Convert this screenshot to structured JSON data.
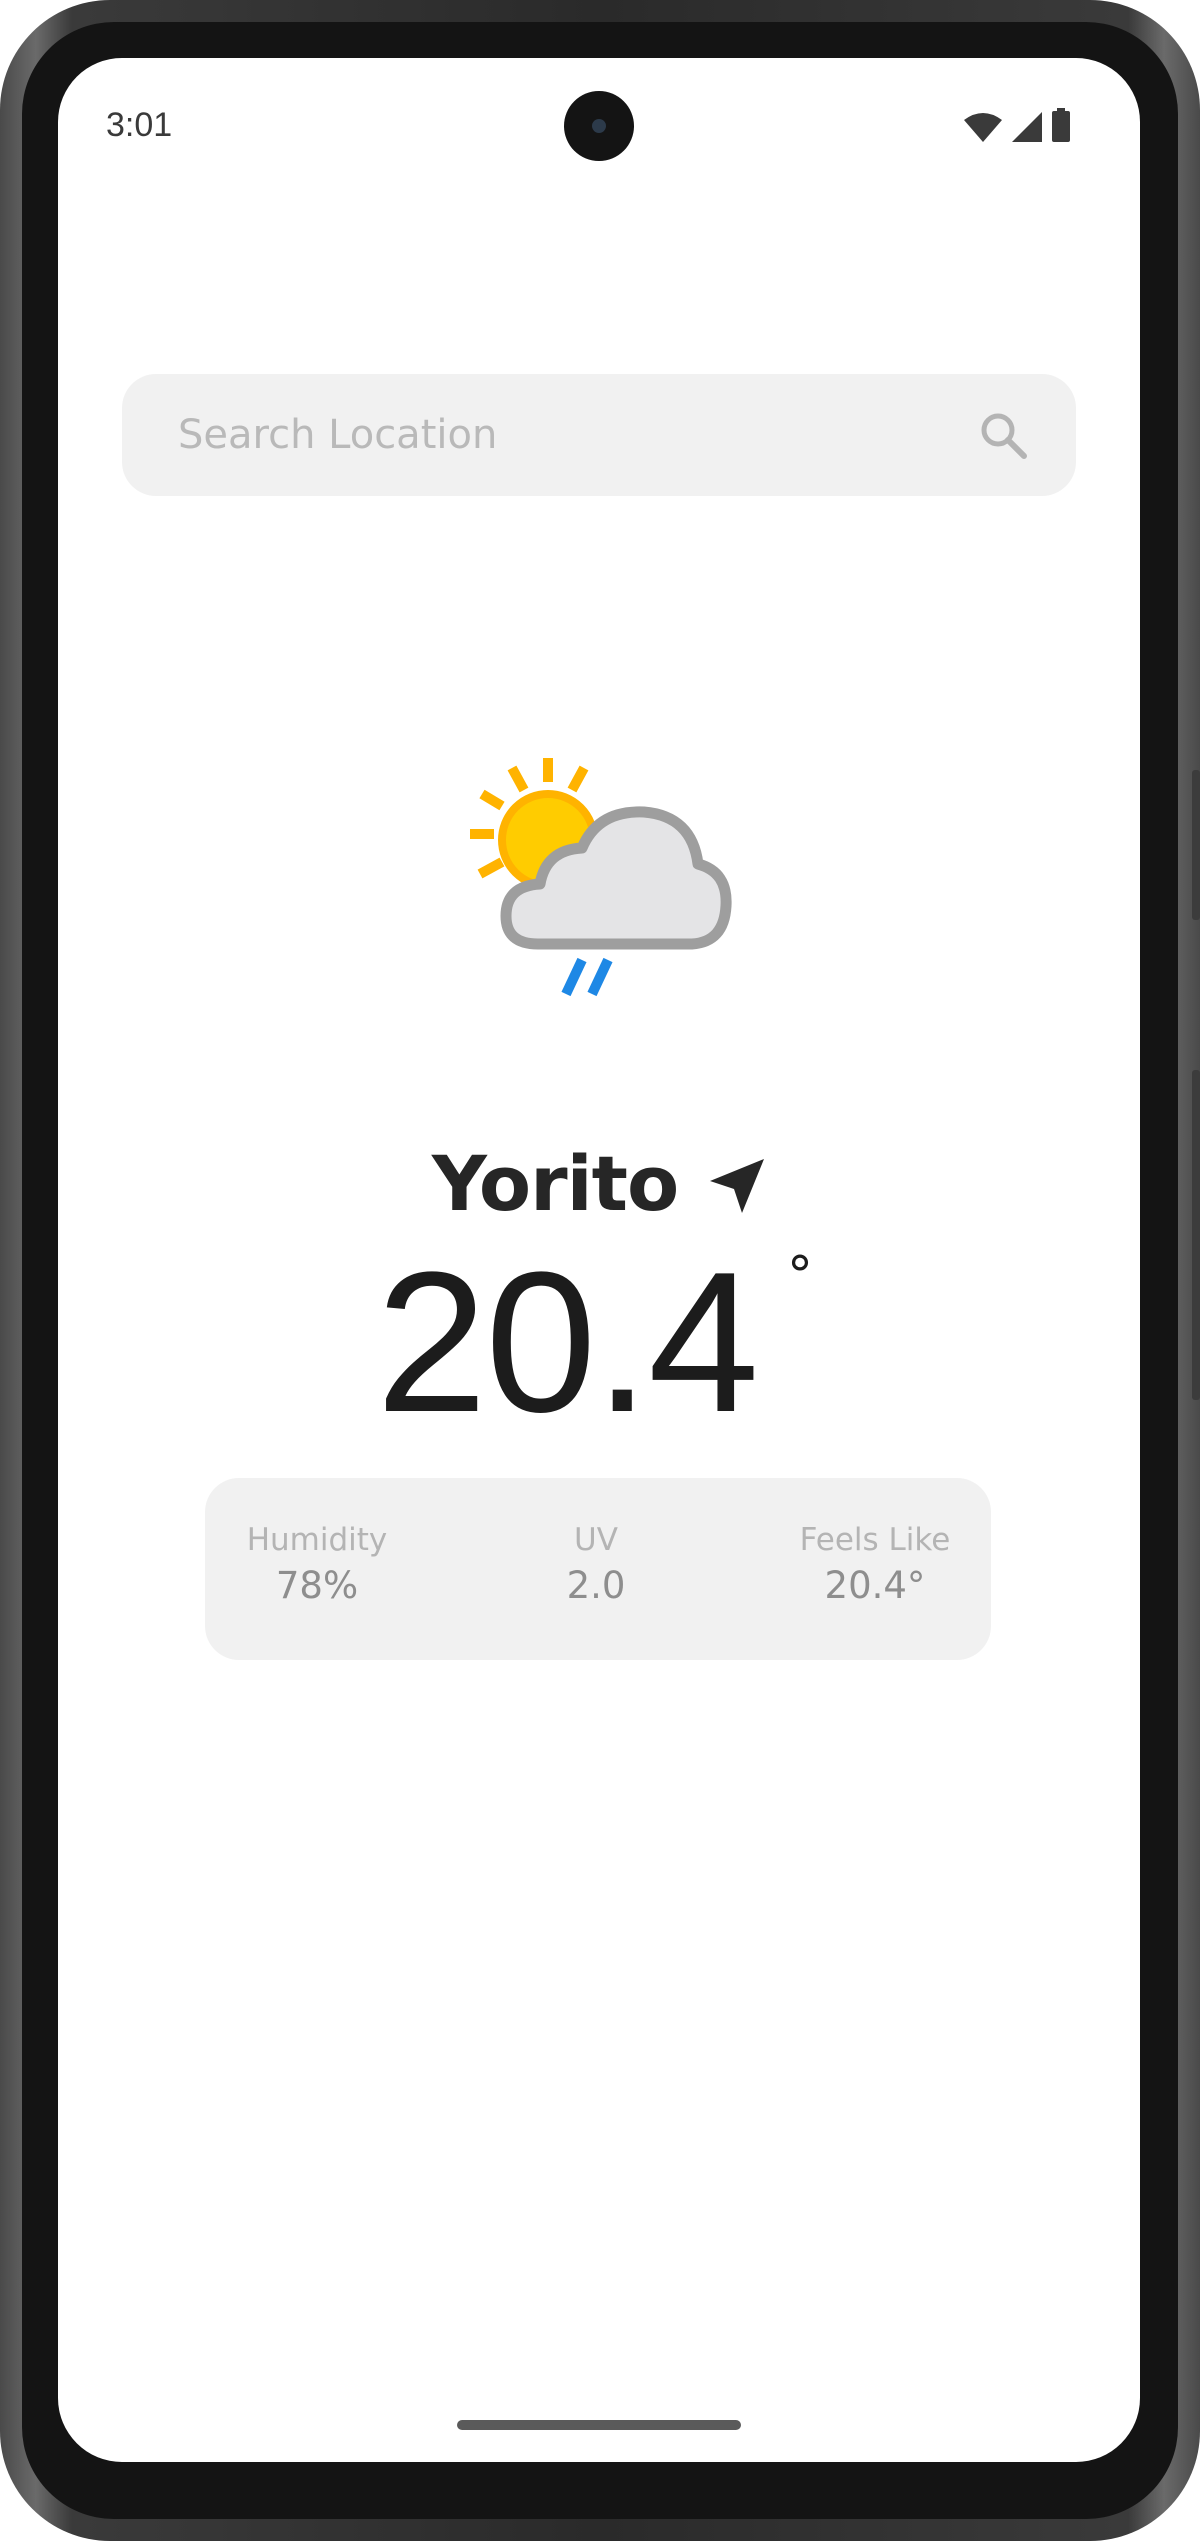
{
  "status_bar": {
    "time": "3:01",
    "icons": [
      "wifi-icon",
      "cellular-signal-icon",
      "battery-icon"
    ]
  },
  "search": {
    "placeholder": "Search Location",
    "value": "",
    "icon": "search-icon"
  },
  "weather": {
    "condition_icon": "partly-cloudy-rain-icon",
    "location": "Yorito",
    "location_icon": "navigation-arrow-icon",
    "temperature": "20.4",
    "temperature_unit": "°"
  },
  "stats": [
    {
      "label": "Humidity",
      "value": "78%"
    },
    {
      "label": "UV",
      "value": "2.0"
    },
    {
      "label": "Feels Like",
      "value": "20.4°"
    }
  ],
  "colors": {
    "accent_rain": "#1e88e5",
    "sun": "#ffb300",
    "cloud": "#9e9e9e",
    "card_bg": "#f1f1f1"
  }
}
